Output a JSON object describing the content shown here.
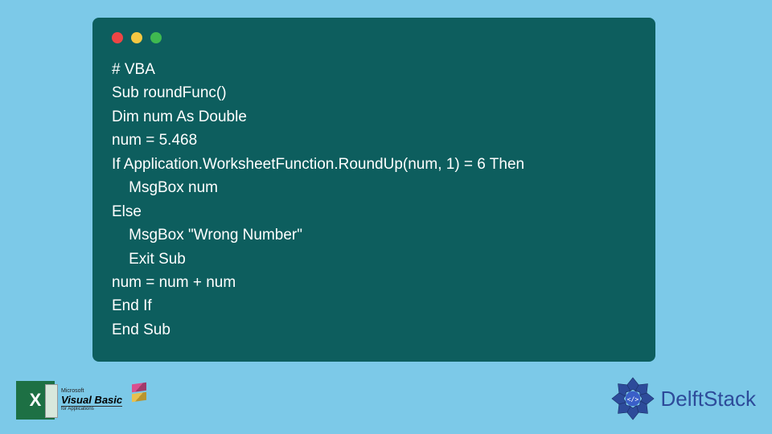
{
  "code": {
    "line1": "# VBA",
    "line2": "Sub roundFunc()",
    "line3": "Dim num As Double",
    "line4": "num = 5.468",
    "line5": "If Application.WorksheetFunction.RoundUp(num, 1) = 6 Then",
    "line6": "    MsgBox num",
    "line7": "Else",
    "line8": "    MsgBox \"Wrong Number\"",
    "line9": "    Exit Sub",
    "line10": "num = num + num",
    "line11": "End If",
    "line12": "End Sub"
  },
  "excel_letter": "X",
  "vb_logo": {
    "top": "Microsoft",
    "main": "Visual Basic",
    "sub": "for Applications"
  },
  "delft_brand": "DelftStack"
}
